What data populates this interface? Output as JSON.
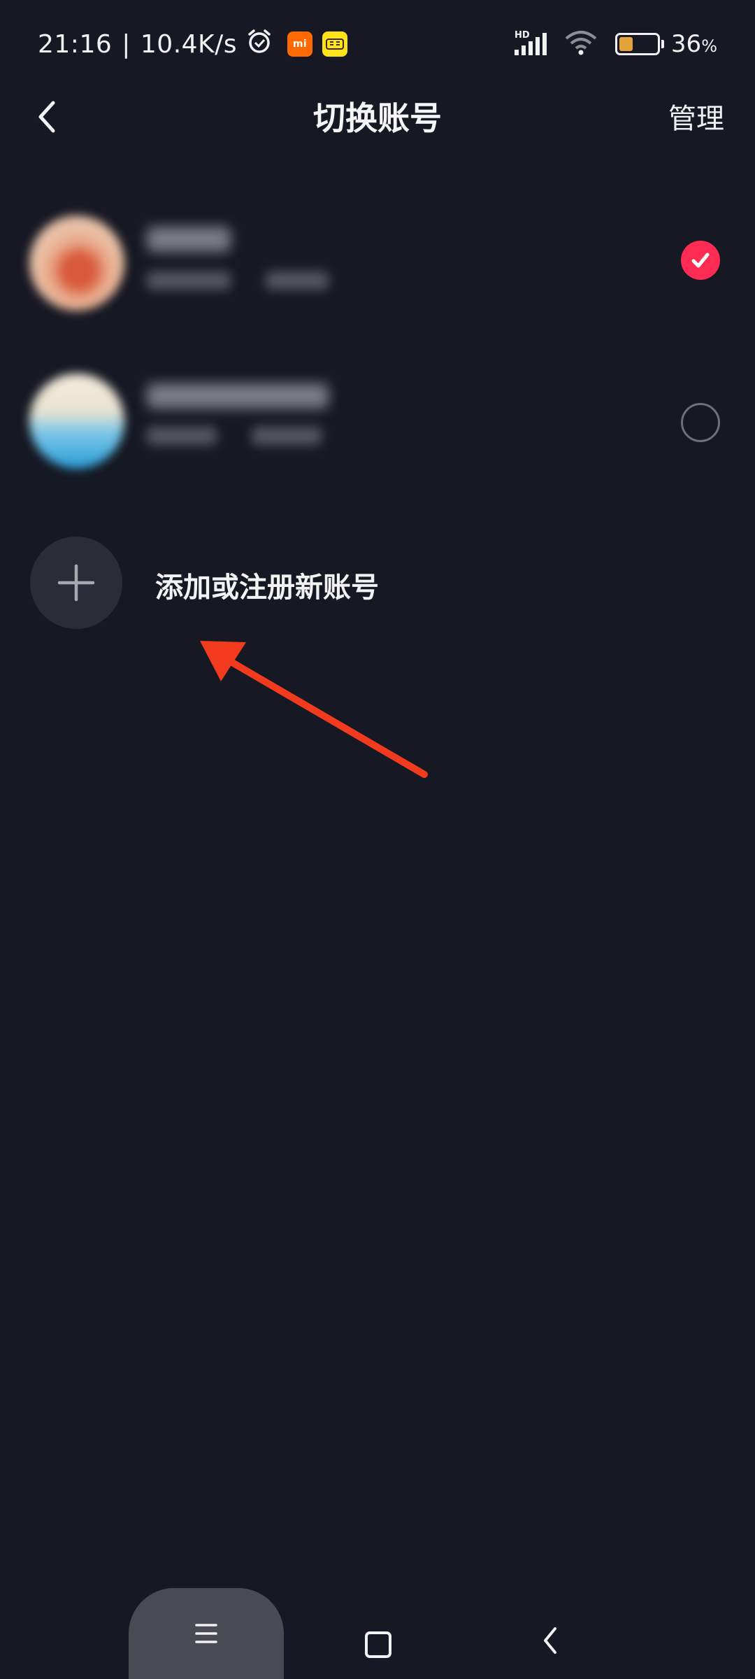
{
  "status_bar": {
    "time": "21:16",
    "separator": "|",
    "network_speed": "10.4K/s",
    "app_badge_1": "mi",
    "app_badge_2": "闲鱼",
    "signal_label": "HD",
    "battery_value": "36",
    "battery_unit": "%",
    "battery_level": 0.36,
    "icons": [
      "alarm-icon",
      "signal-icon",
      "wifi-icon",
      "battery-icon"
    ]
  },
  "header": {
    "title": "切换账号",
    "manage_label": "管理",
    "icons": [
      "back-arrow-icon"
    ]
  },
  "accounts": [
    {
      "selected": true
    },
    {
      "selected": false
    }
  ],
  "add_account": {
    "label": "添加或注册新账号",
    "icon": "plus-icon"
  },
  "system_nav": {
    "icons": [
      "menu-icon",
      "home-icon",
      "back-icon"
    ]
  },
  "colors": {
    "background": "#161823",
    "accent": "#fe2c55",
    "annotation_arrow": "#f23a1e",
    "add_circle": "#2a2c37"
  }
}
